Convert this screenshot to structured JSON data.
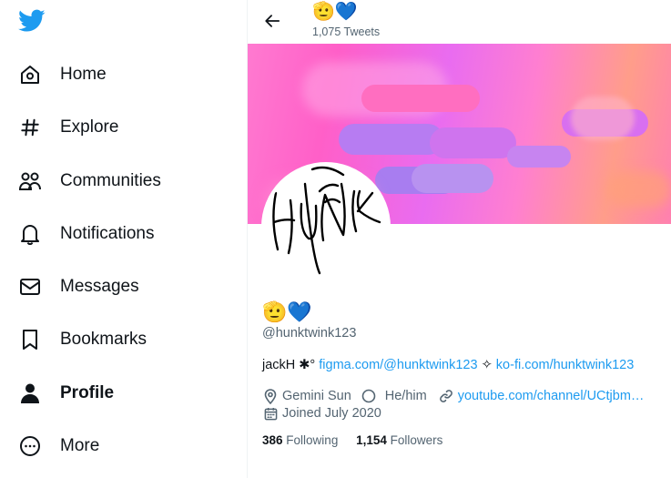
{
  "colors": {
    "accent": "#1d9bf0",
    "text": "#0f1419",
    "muted": "#536471"
  },
  "sidebar": {
    "logo_icon": "twitter-bird-icon",
    "items": [
      {
        "label": "Home",
        "icon": "home-icon"
      },
      {
        "label": "Explore",
        "icon": "hashtag-icon"
      },
      {
        "label": "Communities",
        "icon": "communities-icon"
      },
      {
        "label": "Notifications",
        "icon": "bell-icon"
      },
      {
        "label": "Messages",
        "icon": "envelope-icon"
      },
      {
        "label": "Bookmarks",
        "icon": "bookmark-icon"
      },
      {
        "label": "Profile",
        "icon": "person-icon",
        "active": true
      },
      {
        "label": "More",
        "icon": "more-circle-icon"
      }
    ]
  },
  "header": {
    "title": "🫡💙",
    "tweet_count": "1,075 Tweets"
  },
  "profile": {
    "display_name": "🫡💙",
    "handle": "@hunktwink123",
    "bio_prefix": "jackH ✱° ",
    "bio_link1": "figma.com/@hunktwink123",
    "bio_sep": " ✧ ",
    "bio_link2": "ko-fi.com/hunktwink123",
    "location": "Gemini Sun",
    "pronouns": "He/him",
    "website": "youtube.com/channel/UCtjbm…",
    "joined": "Joined July 2020",
    "following_count": "386",
    "following_label": "Following",
    "followers_count": "1,154",
    "followers_label": "Followers"
  }
}
